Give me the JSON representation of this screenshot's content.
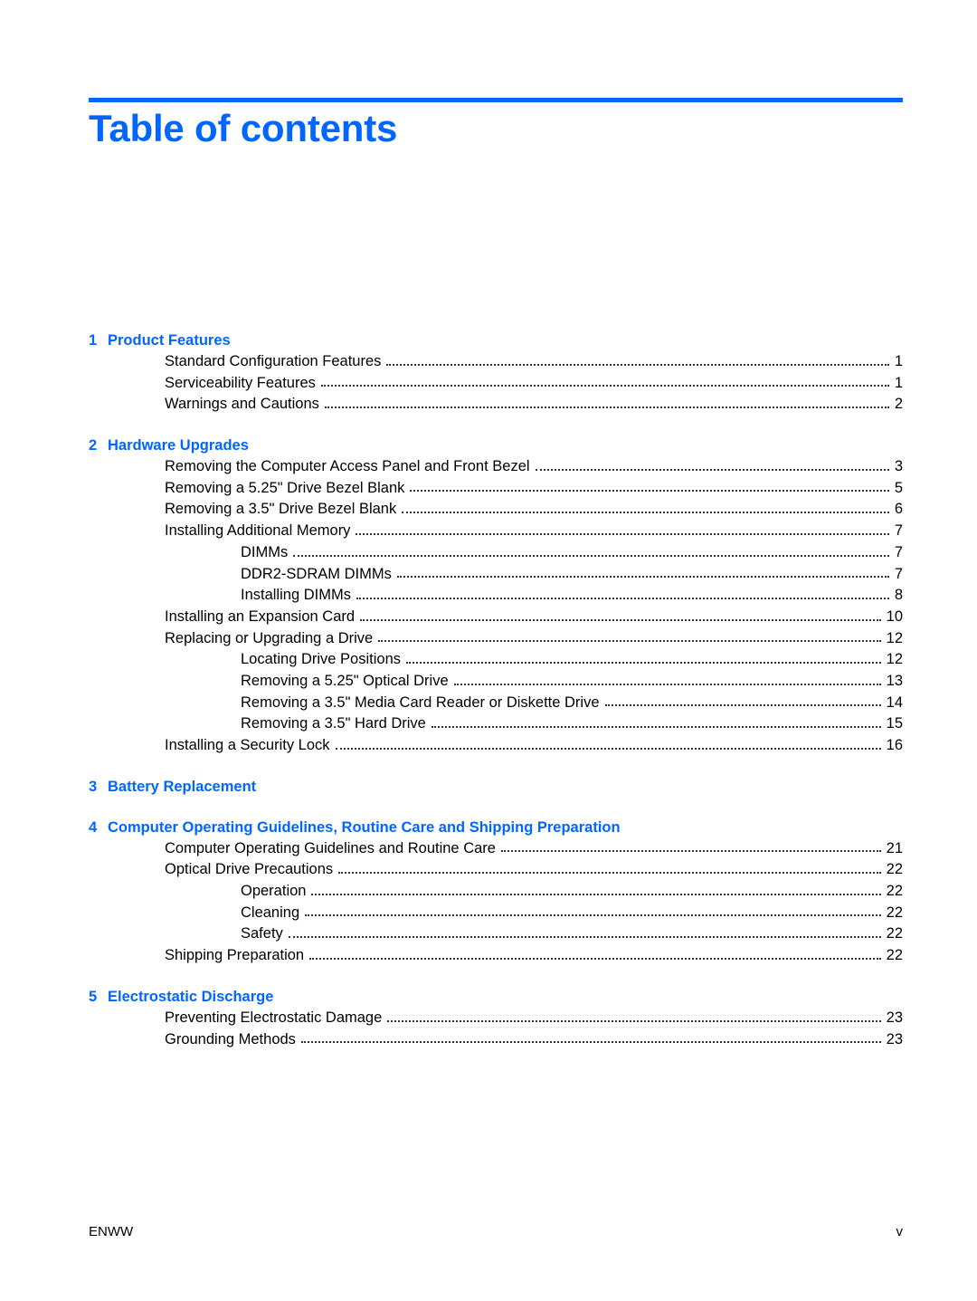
{
  "title": "Table of contents",
  "chapters": [
    {
      "number": "1",
      "title": "Product Features",
      "entries": [
        {
          "label": "Standard Configuration Features",
          "page": "1",
          "level": 1
        },
        {
          "label": "Serviceability Features",
          "page": "1",
          "level": 1
        },
        {
          "label": "Warnings and Cautions",
          "page": "2",
          "level": 1
        }
      ]
    },
    {
      "number": "2",
      "title": "Hardware Upgrades",
      "entries": [
        {
          "label": "Removing the Computer Access Panel and Front Bezel",
          "page": "3",
          "level": 1
        },
        {
          "label": "Removing a 5.25\" Drive Bezel Blank",
          "page": "5",
          "level": 1
        },
        {
          "label": "Removing a 3.5\" Drive Bezel Blank",
          "page": "6",
          "level": 1
        },
        {
          "label": "Installing Additional Memory",
          "page": "7",
          "level": 1
        },
        {
          "label": "DIMMs",
          "page": "7",
          "level": 2
        },
        {
          "label": "DDR2-SDRAM DIMMs",
          "page": "7",
          "level": 2
        },
        {
          "label": "Installing DIMMs",
          "page": "8",
          "level": 2
        },
        {
          "label": "Installing an Expansion Card",
          "page": "10",
          "level": 1
        },
        {
          "label": "Replacing or Upgrading a Drive",
          "page": "12",
          "level": 1
        },
        {
          "label": "Locating Drive Positions",
          "page": "12",
          "level": 2
        },
        {
          "label": "Removing a 5.25\" Optical Drive",
          "page": "13",
          "level": 2
        },
        {
          "label": "Removing a 3.5\" Media Card Reader or Diskette Drive",
          "page": "14",
          "level": 2
        },
        {
          "label": "Removing a 3.5\" Hard Drive",
          "page": "15",
          "level": 2
        },
        {
          "label": "Installing a Security Lock",
          "page": "16",
          "level": 1
        }
      ]
    },
    {
      "number": "3",
      "title": "Battery Replacement",
      "entries": []
    },
    {
      "number": "4",
      "title": "Computer Operating Guidelines, Routine Care and Shipping Preparation",
      "entries": [
        {
          "label": "Computer Operating Guidelines and Routine Care",
          "page": "21",
          "level": 1
        },
        {
          "label": "Optical Drive Precautions",
          "page": "22",
          "level": 1
        },
        {
          "label": "Operation",
          "page": "22",
          "level": 2
        },
        {
          "label": "Cleaning",
          "page": "22",
          "level": 2
        },
        {
          "label": "Safety",
          "page": "22",
          "level": 2
        },
        {
          "label": "Shipping Preparation",
          "page": "22",
          "level": 1
        }
      ]
    },
    {
      "number": "5",
      "title": "Electrostatic Discharge",
      "entries": [
        {
          "label": "Preventing Electrostatic Damage",
          "page": "23",
          "level": 1
        },
        {
          "label": "Grounding Methods",
          "page": "23",
          "level": 1
        }
      ]
    }
  ],
  "footer": {
    "left": "ENWW",
    "right": "v"
  }
}
